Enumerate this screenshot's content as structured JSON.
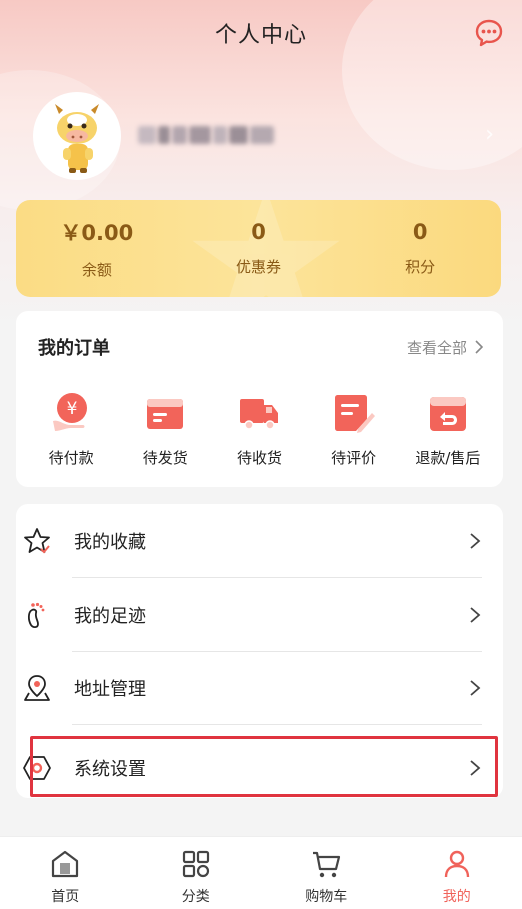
{
  "header": {
    "title": "个人中心",
    "message_icon": "chat-bubble-icon"
  },
  "profile": {
    "username": "",
    "avatar": "cow-mascot-avatar"
  },
  "stats": [
    {
      "value": "￥0.00",
      "label": "余额"
    },
    {
      "value": "0",
      "label": "优惠券"
    },
    {
      "value": "0",
      "label": "积分"
    }
  ],
  "orders": {
    "title": "我的订单",
    "view_all": "查看全部",
    "items": [
      {
        "label": "待付款",
        "icon": "pending-payment-icon"
      },
      {
        "label": "待发货",
        "icon": "pending-shipment-icon"
      },
      {
        "label": "待收货",
        "icon": "delivery-truck-icon"
      },
      {
        "label": "待评价",
        "icon": "review-icon"
      },
      {
        "label": "退款/售后",
        "icon": "refund-icon"
      }
    ]
  },
  "menu": [
    {
      "label": "我的收藏",
      "icon": "star-icon"
    },
    {
      "label": "我的足迹",
      "icon": "footprint-icon"
    },
    {
      "label": "地址管理",
      "icon": "location-icon"
    },
    {
      "label": "系统设置",
      "icon": "settings-icon"
    }
  ],
  "tabbar": [
    {
      "label": "首页",
      "icon": "home-icon",
      "active": false
    },
    {
      "label": "分类",
      "icon": "category-icon",
      "active": false
    },
    {
      "label": "购物车",
      "icon": "cart-icon",
      "active": false
    },
    {
      "label": "我的",
      "icon": "user-icon",
      "active": true
    }
  ],
  "colors": {
    "accent": "#f0625a",
    "gold_text": "#8a5a16",
    "highlight": "#e0343f"
  }
}
